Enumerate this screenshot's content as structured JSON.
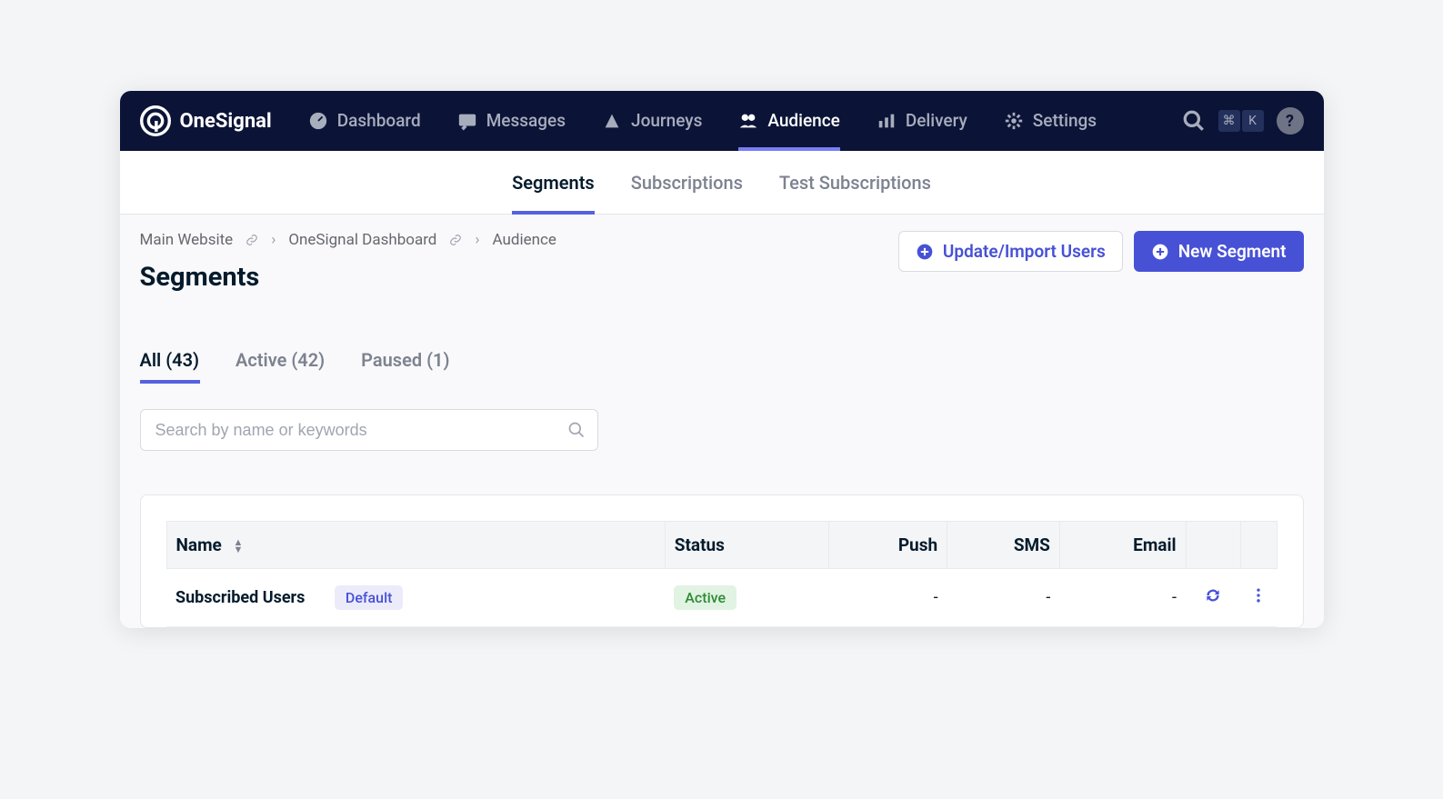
{
  "brand": "OneSignal",
  "topnav": [
    {
      "label": "Dashboard",
      "icon": "dashboard"
    },
    {
      "label": "Messages",
      "icon": "messages"
    },
    {
      "label": "Journeys",
      "icon": "journeys"
    },
    {
      "label": "Audience",
      "icon": "audience",
      "active": true
    },
    {
      "label": "Delivery",
      "icon": "delivery"
    },
    {
      "label": "Settings",
      "icon": "settings"
    }
  ],
  "shortcut_keys": [
    "⌘",
    "K"
  ],
  "subnav": [
    {
      "label": "Segments",
      "active": true
    },
    {
      "label": "Subscriptions"
    },
    {
      "label": "Test Subscriptions"
    }
  ],
  "breadcrumb": [
    {
      "label": "Main Website",
      "link": true
    },
    {
      "label": "OneSignal Dashboard",
      "link": true
    },
    {
      "label": "Audience"
    }
  ],
  "actions": {
    "update_import": "Update/Import Users",
    "new_segment": "New Segment"
  },
  "page_title": "Segments",
  "filter_tabs": [
    {
      "label": "All (43)",
      "active": true
    },
    {
      "label": "Active (42)"
    },
    {
      "label": "Paused (1)"
    }
  ],
  "search": {
    "placeholder": "Search by name or keywords"
  },
  "table": {
    "columns": {
      "name": "Name",
      "status": "Status",
      "push": "Push",
      "sms": "SMS",
      "email": "Email"
    },
    "rows": [
      {
        "name": "Subscribed Users",
        "tag": "Default",
        "status": "Active",
        "push": "-",
        "sms": "-",
        "email": "-"
      }
    ]
  }
}
